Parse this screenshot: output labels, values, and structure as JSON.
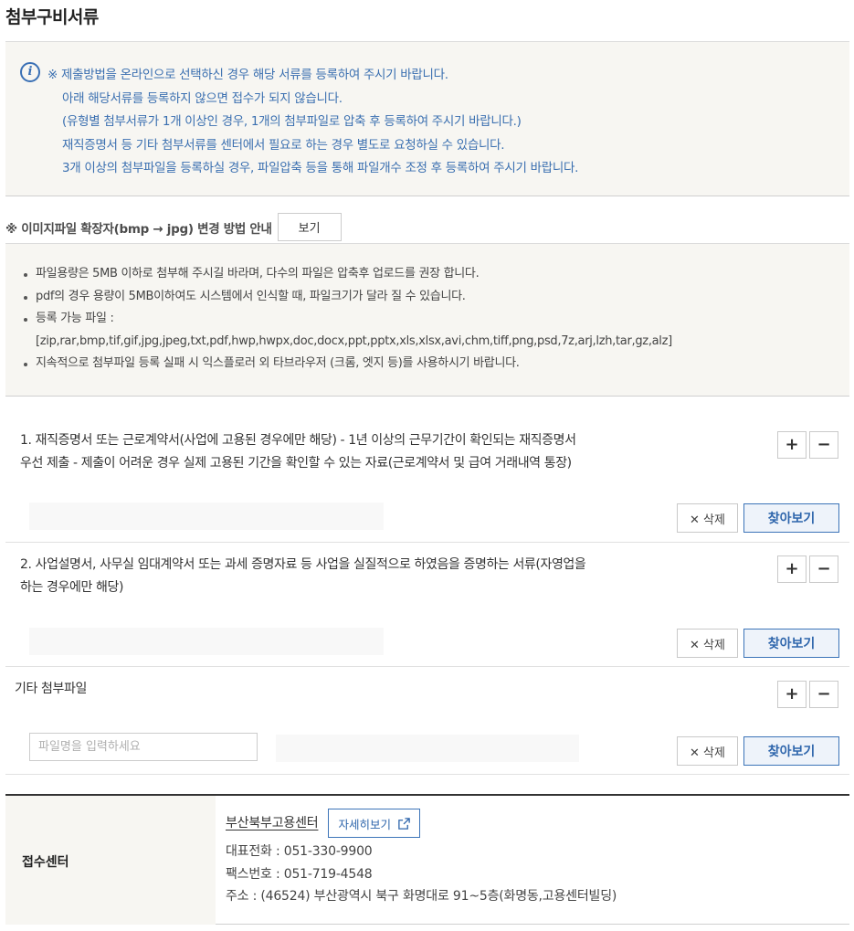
{
  "page": {
    "title": "첨부구비서류"
  },
  "notice": {
    "icon": "info-icon",
    "lines": [
      "※ 제출방법을 온라인으로 선택하신 경우 해당 서류를 등록하여 주시기 바랍니다.",
      "아래 해당서류를 등록하지 않으면 접수가 되지 않습니다.",
      "(유형별 첨부서류가 1개 이상인 경우, 1개의 첨부파일로 압축 후 등록하여 주시기 바랍니다.)",
      "재직증명서 등 기타 첨부서류를 센터에서 필요로 하는 경우 별도로 요청하실 수 있습니다.",
      "3개 이상의 첨부파일을 등록하실 경우, 파일압축 등을 통해 파일개수 조정 후 등록하여 주시기 바랍니다."
    ]
  },
  "ext_guide": {
    "text": "※ 이미지파일 확장자(bmp → jpg) 변경 방법 안내",
    "button": "보기"
  },
  "guide": {
    "items": [
      "파일용량은 5MB 이하로 첨부해 주시길 바라며, 다수의 파일은 압축후 업로드를 권장 합니다.",
      "pdf의 경우 용량이 5MB이하여도 시스템에서 인식할 때, 파일크기가 달라 질 수 있습니다.",
      "등록 가능 파일 :"
    ],
    "allowed_ext": "[zip,rar,bmp,tif,gif,jpg,jpeg,txt,pdf,hwp,hwpx,doc,docx,ppt,pptx,xls,xlsx,avi,chm,tiff,png,psd,7z,arj,lzh,tar,gz,alz]",
    "last_item": "지속적으로 첨부파일 등록 실패 시 익스플로러 외 타브라우저 (크롬, 엣지 등)를 사용하시기 바랍니다."
  },
  "attachments": [
    {
      "line1": "1. 재직증명서 또는 근로계약서(사업에 고용된 경우에만 해당) - 1년 이상의 근무기간이 확인되는 재직증명서",
      "line2": "우선 제출 - 제출이 어려운 경우 실제 고용된 기간을 확인할 수 있는 자료(근로계약서 및 급여 거래내역 통장)"
    },
    {
      "line1": "2. 사업설명서, 사무실 임대계약서 또는 과세 증명자료 등 사업을 실질적으로 하였음을 증명하는 서류(자영업을",
      "line2": "하는 경우에만 해당)"
    },
    {
      "line1": "기타 첨부파일",
      "name_placeholder": "파일명을 입력하세요"
    }
  ],
  "buttons": {
    "plus": "+",
    "minus": "−",
    "delete": "✕ 삭제",
    "browse": "찾아보기"
  },
  "center": {
    "label": "접수센터",
    "name": "부산북부고용센터",
    "detail_button": "자세히보기",
    "phone": "대표전화 : 051-330-9900",
    "fax": "팩스번호 : 051-719-4548",
    "address": "주소 : (46524) 부산광역시 북구 화명대로 91~5층(화명동,고용센터빌딩)"
  },
  "colors": {
    "accent_blue": "#3a6fb0",
    "panel_bg": "#f7f6f2"
  }
}
